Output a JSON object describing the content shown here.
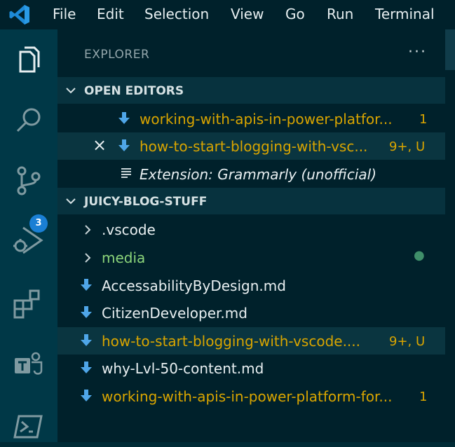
{
  "menubar": {
    "items": [
      "File",
      "Edit",
      "Selection",
      "View",
      "Go",
      "Run",
      "Terminal"
    ]
  },
  "activity_bar": {
    "icons": [
      "explorer-icon",
      "search-icon",
      "source-control-icon",
      "run-debug-icon",
      "extensions-icon",
      "teams-icon",
      "powershell-icon"
    ],
    "source_control_badge": "3",
    "colors": {
      "badge": "#1a7fd4"
    }
  },
  "sidebar": {
    "title": "EXPLORER",
    "more": "···",
    "open_editors": {
      "label": "OPEN EDITORS",
      "items": [
        {
          "name": "working-with-apis-in-power-platfor...",
          "badge": "1",
          "icon": "download-arrow-icon"
        },
        {
          "name": "how-to-start-blogging-with-vsc...",
          "badge": "9+, U",
          "icon": "download-arrow-icon",
          "close": "×"
        },
        {
          "name": "Extension: Grammarly (unofficial)",
          "badge": "",
          "icon": "list-icon"
        }
      ]
    },
    "workspace": {
      "label": "JUICY-BLOG-STUFF",
      "items": [
        {
          "name": ".vscode",
          "type": "folder"
        },
        {
          "name": "media",
          "type": "folder",
          "dot": "●"
        },
        {
          "name": "AccessabilityByDesign.md",
          "type": "file"
        },
        {
          "name": "CitizenDeveloper.md",
          "type": "file"
        },
        {
          "name": "how-to-start-blogging-with-vscode....",
          "type": "file",
          "badge": "9+, U"
        },
        {
          "name": "why-Lvl-50-content.md",
          "type": "file"
        },
        {
          "name": "working-with-apis-in-power-platform-for...",
          "type": "file",
          "badge": "1"
        }
      ]
    }
  },
  "colors": {
    "modified": "#d9a500",
    "untracked_folder": "#8bd47a",
    "background": "#00212b",
    "activity_bar": "#003847"
  }
}
